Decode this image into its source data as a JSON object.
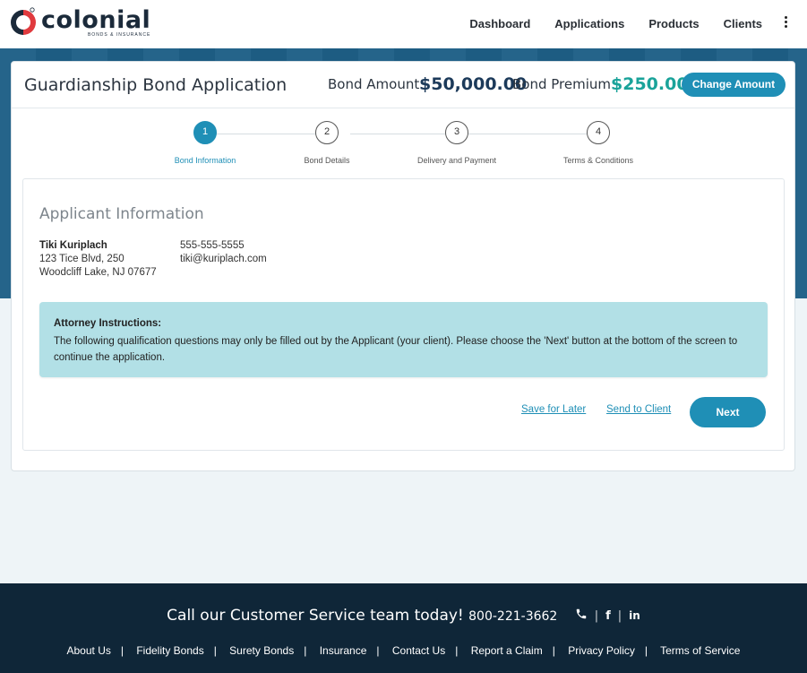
{
  "header": {
    "logo_word": "colonial",
    "logo_sub": "BONDS & INSURANCE",
    "nav": [
      "Dashboard",
      "Applications",
      "Products",
      "Clients"
    ]
  },
  "card": {
    "title": "Guardianship Bond Application",
    "bond_amount_label": "Bond Amount:",
    "bond_amount_value": "$50,000.00",
    "bond_premium_label": "Bond Premium:",
    "bond_premium_value": "$250.00",
    "change_amount_label": "Change Amount"
  },
  "steps": [
    {
      "num": "1",
      "label": "Bond Information",
      "active": true
    },
    {
      "num": "2",
      "label": "Bond Details",
      "active": false
    },
    {
      "num": "3",
      "label": "Delivery and Payment",
      "active": false
    },
    {
      "num": "4",
      "label": "Terms & Conditions",
      "active": false
    }
  ],
  "applicant": {
    "section_title": "Applicant Information",
    "name": "Tiki Kuriplach",
    "address_line1": "123 Tice Blvd, 250",
    "address_line2": "Woodcliff Lake, NJ 07677",
    "phone": "555-555-5555",
    "email": "tiki@kuriplach.com"
  },
  "notice": {
    "title": "Attorney Instructions:",
    "text": "The following qualification questions may only be filled out by the Applicant (your client). Please choose the 'Next' button at the bottom of the screen to continue the application."
  },
  "actions": {
    "save_later": "Save for Later",
    "send_client": "Send to Client",
    "next": "Next"
  },
  "footer": {
    "cta_text": "Call our Customer Service team today!",
    "cta_phone": "800-221-3662",
    "links": [
      "About Us",
      "Fidelity Bonds",
      "Surety Bonds",
      "Insurance",
      "Contact Us",
      "Report a Claim",
      "Privacy Policy",
      "Terms of Service"
    ]
  },
  "colors": {
    "accent": "#1f8fb6",
    "premium": "#1aa39a",
    "banner": "#1e5f86",
    "footer": "#0f2638",
    "notice_bg": "#b2e0e6"
  }
}
